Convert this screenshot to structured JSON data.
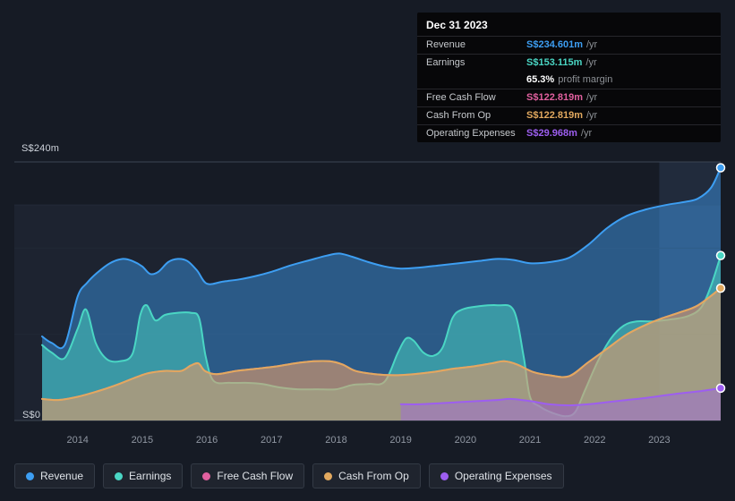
{
  "tooltip": {
    "date": "Dec 31 2023",
    "rows": [
      {
        "label": "Revenue",
        "value": "S$234.601m",
        "suffix": "/yr",
        "color": "#3d9ef2",
        "divider": true
      },
      {
        "label": "Earnings",
        "value": "S$153.115m",
        "suffix": "/yr",
        "color": "#4ad6c4",
        "divider": true
      },
      {
        "label": "",
        "value": "65.3%",
        "suffix": "profit margin",
        "color": "#ffffff",
        "divider": false
      },
      {
        "label": "Free Cash Flow",
        "value": "S$122.819m",
        "suffix": "/yr",
        "color": "#e1609f",
        "divider": true
      },
      {
        "label": "Cash From Op",
        "value": "S$122.819m",
        "suffix": "/yr",
        "color": "#e2a95f",
        "divider": true
      },
      {
        "label": "Operating Expenses",
        "value": "S$29.968m",
        "suffix": "/yr",
        "color": "#9d5ef0",
        "divider": true
      }
    ]
  },
  "legend": {
    "items": [
      {
        "label": "Revenue",
        "color": "#3d9ef2"
      },
      {
        "label": "Earnings",
        "color": "#4ad6c4"
      },
      {
        "label": "Free Cash Flow",
        "color": "#e1609f"
      },
      {
        "label": "Cash From Op",
        "color": "#e2a95f"
      },
      {
        "label": "Operating Expenses",
        "color": "#9d5ef0"
      }
    ]
  },
  "chart_data": {
    "type": "area",
    "title": "Earnings and revenue history",
    "x_domain": [
      2013.45,
      2023.95
    ],
    "y_domain": [
      0,
      240
    ],
    "band_above": 200,
    "highlight_x": [
      2023.0,
      2023.95
    ],
    "y_axis": {
      "top_label": "S$240m",
      "bottom_label": "S$0"
    },
    "x_ticks": [
      2014,
      2015,
      2016,
      2017,
      2018,
      2019,
      2020,
      2021,
      2022,
      2023
    ],
    "series": [
      {
        "name": "Revenue",
        "color": "#3d9ef2",
        "fill_opacity": 0.45,
        "marker": true,
        "points": [
          [
            2013.45,
            78
          ],
          [
            2013.6,
            72
          ],
          [
            2013.8,
            70
          ],
          [
            2014.0,
            115
          ],
          [
            2014.15,
            128
          ],
          [
            2014.3,
            137
          ],
          [
            2014.5,
            146
          ],
          [
            2014.7,
            150
          ],
          [
            2014.85,
            148
          ],
          [
            2015.0,
            143
          ],
          [
            2015.12,
            136
          ],
          [
            2015.25,
            138
          ],
          [
            2015.4,
            147
          ],
          [
            2015.55,
            150
          ],
          [
            2015.7,
            148
          ],
          [
            2015.85,
            139
          ],
          [
            2016.0,
            127
          ],
          [
            2016.25,
            129
          ],
          [
            2016.5,
            131
          ],
          [
            2016.75,
            134
          ],
          [
            2017.0,
            138
          ],
          [
            2017.3,
            144
          ],
          [
            2017.6,
            149
          ],
          [
            2017.85,
            153
          ],
          [
            2018.05,
            155
          ],
          [
            2018.25,
            152
          ],
          [
            2018.5,
            147
          ],
          [
            2018.75,
            143
          ],
          [
            2019.0,
            141
          ],
          [
            2019.3,
            142
          ],
          [
            2019.6,
            144
          ],
          [
            2019.9,
            146
          ],
          [
            2020.2,
            148
          ],
          [
            2020.5,
            150
          ],
          [
            2020.75,
            149
          ],
          [
            2021.0,
            146
          ],
          [
            2021.3,
            147
          ],
          [
            2021.6,
            151
          ],
          [
            2021.9,
            163
          ],
          [
            2022.2,
            179
          ],
          [
            2022.5,
            190
          ],
          [
            2022.8,
            196
          ],
          [
            2023.1,
            200
          ],
          [
            2023.4,
            203
          ],
          [
            2023.6,
            206
          ],
          [
            2023.8,
            216
          ],
          [
            2023.95,
            234.6
          ]
        ]
      },
      {
        "name": "Earnings",
        "color": "#4ad6c4",
        "fill_opacity": 0.5,
        "marker": true,
        "points": [
          [
            2013.45,
            70
          ],
          [
            2013.6,
            63
          ],
          [
            2013.8,
            58
          ],
          [
            2014.0,
            85
          ],
          [
            2014.13,
            103
          ],
          [
            2014.28,
            72
          ],
          [
            2014.45,
            57
          ],
          [
            2014.65,
            55
          ],
          [
            2014.85,
            62
          ],
          [
            2014.97,
            98
          ],
          [
            2015.07,
            107
          ],
          [
            2015.2,
            93
          ],
          [
            2015.35,
            98
          ],
          [
            2015.55,
            100
          ],
          [
            2015.75,
            100
          ],
          [
            2015.88,
            95
          ],
          [
            2015.98,
            60
          ],
          [
            2016.1,
            37
          ],
          [
            2016.35,
            35
          ],
          [
            2016.6,
            35
          ],
          [
            2016.85,
            34
          ],
          [
            2017.1,
            31
          ],
          [
            2017.4,
            29
          ],
          [
            2017.7,
            29
          ],
          [
            2018.0,
            29
          ],
          [
            2018.25,
            33
          ],
          [
            2018.5,
            34
          ],
          [
            2018.75,
            36
          ],
          [
            2018.95,
            62
          ],
          [
            2019.08,
            76
          ],
          [
            2019.2,
            74
          ],
          [
            2019.35,
            63
          ],
          [
            2019.5,
            60
          ],
          [
            2019.65,
            68
          ],
          [
            2019.8,
            95
          ],
          [
            2019.95,
            103
          ],
          [
            2020.2,
            106
          ],
          [
            2020.5,
            107
          ],
          [
            2020.75,
            102
          ],
          [
            2020.9,
            60
          ],
          [
            2021.0,
            22
          ],
          [
            2021.15,
            13
          ],
          [
            2021.35,
            7
          ],
          [
            2021.55,
            4
          ],
          [
            2021.7,
            8
          ],
          [
            2021.85,
            28
          ],
          [
            2022.05,
            55
          ],
          [
            2022.25,
            76
          ],
          [
            2022.45,
            88
          ],
          [
            2022.65,
            92
          ],
          [
            2022.9,
            92
          ],
          [
            2023.2,
            94
          ],
          [
            2023.45,
            97
          ],
          [
            2023.65,
            105
          ],
          [
            2023.8,
            125
          ],
          [
            2023.95,
            153.1
          ]
        ]
      },
      {
        "name": "Free Cash Flow",
        "color": "#e1609f",
        "fill_opacity": 0.22,
        "marker": false,
        "points": [
          [
            2013.45,
            20
          ],
          [
            2013.7,
            19
          ],
          [
            2014.0,
            22
          ],
          [
            2014.3,
            27
          ],
          [
            2014.6,
            33
          ],
          [
            2014.9,
            40
          ],
          [
            2015.1,
            44
          ],
          [
            2015.35,
            46
          ],
          [
            2015.6,
            46
          ],
          [
            2015.75,
            51
          ],
          [
            2015.87,
            53
          ],
          [
            2015.97,
            46
          ],
          [
            2016.15,
            43
          ],
          [
            2016.45,
            46
          ],
          [
            2016.75,
            48
          ],
          [
            2017.05,
            50
          ],
          [
            2017.35,
            53
          ],
          [
            2017.65,
            55
          ],
          [
            2017.9,
            55
          ],
          [
            2018.1,
            52
          ],
          [
            2018.3,
            46
          ],
          [
            2018.6,
            43
          ],
          [
            2018.9,
            42
          ],
          [
            2019.2,
            43
          ],
          [
            2019.5,
            45
          ],
          [
            2019.8,
            48
          ],
          [
            2020.1,
            50
          ],
          [
            2020.4,
            53
          ],
          [
            2020.6,
            55
          ],
          [
            2020.8,
            52
          ],
          [
            2021.05,
            45
          ],
          [
            2021.3,
            42
          ],
          [
            2021.6,
            41
          ],
          [
            2021.9,
            54
          ],
          [
            2022.2,
            67
          ],
          [
            2022.5,
            80
          ],
          [
            2022.8,
            89
          ],
          [
            2023.05,
            95
          ],
          [
            2023.3,
            100
          ],
          [
            2023.6,
            107
          ],
          [
            2023.95,
            122.8
          ]
        ]
      },
      {
        "name": "Cash From Op",
        "color": "#e2a95f",
        "fill_opacity": 0.5,
        "marker": true,
        "points": [
          [
            2013.45,
            20
          ],
          [
            2013.7,
            19
          ],
          [
            2014.0,
            22
          ],
          [
            2014.3,
            27
          ],
          [
            2014.6,
            33
          ],
          [
            2014.9,
            40
          ],
          [
            2015.1,
            44
          ],
          [
            2015.35,
            46
          ],
          [
            2015.6,
            46
          ],
          [
            2015.75,
            51
          ],
          [
            2015.87,
            53
          ],
          [
            2015.97,
            46
          ],
          [
            2016.15,
            43
          ],
          [
            2016.45,
            46
          ],
          [
            2016.75,
            48
          ],
          [
            2017.05,
            50
          ],
          [
            2017.35,
            53
          ],
          [
            2017.65,
            55
          ],
          [
            2017.9,
            55
          ],
          [
            2018.1,
            52
          ],
          [
            2018.3,
            46
          ],
          [
            2018.6,
            43
          ],
          [
            2018.9,
            42
          ],
          [
            2019.2,
            43
          ],
          [
            2019.5,
            45
          ],
          [
            2019.8,
            48
          ],
          [
            2020.1,
            50
          ],
          [
            2020.4,
            53
          ],
          [
            2020.6,
            55
          ],
          [
            2020.8,
            52
          ],
          [
            2021.05,
            45
          ],
          [
            2021.3,
            42
          ],
          [
            2021.6,
            41
          ],
          [
            2021.9,
            54
          ],
          [
            2022.2,
            67
          ],
          [
            2022.5,
            80
          ],
          [
            2022.8,
            89
          ],
          [
            2023.05,
            95
          ],
          [
            2023.3,
            100
          ],
          [
            2023.6,
            107
          ],
          [
            2023.95,
            122.8
          ]
        ]
      },
      {
        "name": "Operating Expenses",
        "color": "#9d5ef0",
        "fill_opacity": 0.4,
        "marker": true,
        "points": [
          [
            2019.0,
            15
          ],
          [
            2019.3,
            15
          ],
          [
            2019.6,
            16
          ],
          [
            2019.9,
            17
          ],
          [
            2020.2,
            18
          ],
          [
            2020.5,
            19
          ],
          [
            2020.7,
            20
          ],
          [
            2021.0,
            18
          ],
          [
            2021.3,
            15
          ],
          [
            2021.6,
            14
          ],
          [
            2021.9,
            15
          ],
          [
            2022.2,
            17
          ],
          [
            2022.5,
            19
          ],
          [
            2022.8,
            21
          ],
          [
            2023.05,
            23
          ],
          [
            2023.3,
            25
          ],
          [
            2023.6,
            27
          ],
          [
            2023.95,
            30
          ]
        ]
      }
    ]
  }
}
